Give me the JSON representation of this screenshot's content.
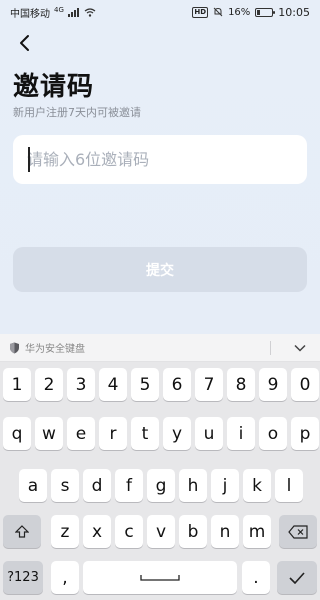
{
  "status_bar": {
    "carrier": "中国移动",
    "network": "4G",
    "hd": "HD",
    "battery": "16%",
    "time": "10:05"
  },
  "page": {
    "title": "邀请码",
    "subtitle": "新用户注册7天内可被邀请",
    "input_placeholder": "请输入6位邀请码",
    "submit_label": "提交"
  },
  "keyboard": {
    "brand": "华为安全键盘",
    "row_numbers": [
      "1",
      "2",
      "3",
      "4",
      "5",
      "6",
      "7",
      "8",
      "9",
      "0"
    ],
    "row1": [
      "q",
      "w",
      "e",
      "r",
      "t",
      "y",
      "u",
      "i",
      "o",
      "p"
    ],
    "row2": [
      "a",
      "s",
      "d",
      "f",
      "g",
      "h",
      "j",
      "k",
      "l"
    ],
    "row3": [
      "z",
      "x",
      "c",
      "v",
      "b",
      "n",
      "m"
    ],
    "symbols_label": "?123",
    "comma": ",",
    "period": "."
  },
  "colors": {
    "background": "#e7eef8",
    "submit_disabled": "#d6dde8",
    "keyboard_bg": "#e7e7e9"
  }
}
